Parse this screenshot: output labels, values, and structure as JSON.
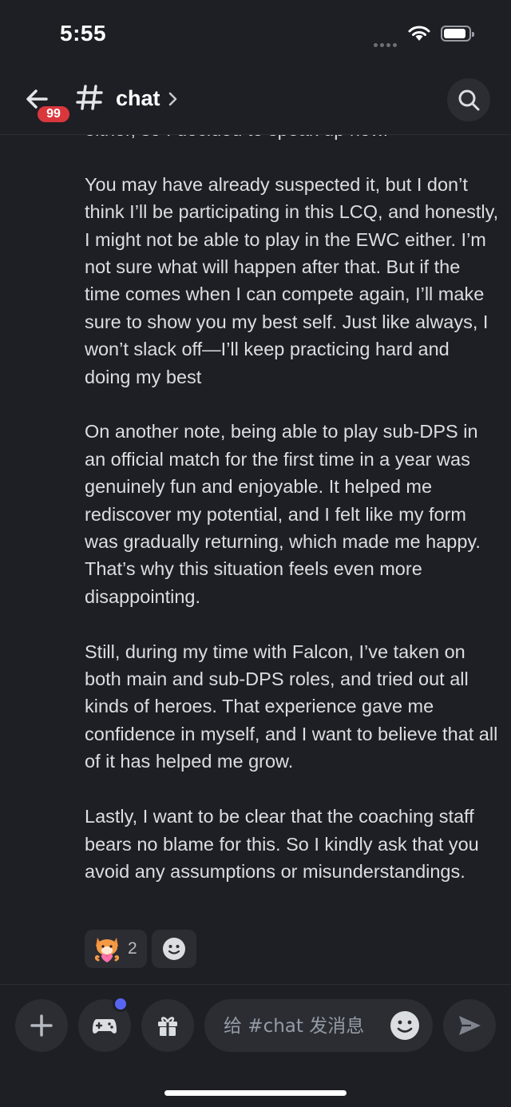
{
  "status": {
    "time": "5:55"
  },
  "header": {
    "back_badge": "99",
    "channel_name": "chat"
  },
  "message": {
    "paragraphs": [
      "either, so I decided to speak up now.",
      "You may have already suspected it, but I don’t think I’ll be participating in this LCQ, and honestly, I might not be able to play in the EWC either. I’m not sure what will happen after that. But if the time comes when I can compete again, I’ll make sure to show you my best self. Just like always, I won’t slack off—I’ll keep practicing hard and doing my best",
      "On another note, being able to play sub-DPS in an official match for the first time in a year was genuinely fun and enjoyable. It helped me rediscover my potential, and I felt like my form was gradually returning, which made me happy. That’s why this situation feels even more disappointing.",
      "Still, during my time with Falcon, I’ve taken on both main and sub-DPS roles, and tried out all kinds of heroes. That experience gave me confidence in myself, and I want to believe that all of it has helped me grow.",
      "Lastly, I want to be clear that the coaching staff bears no blame for this. So I kindly ask that you avoid any assumptions or misunderstandings."
    ],
    "reaction": {
      "emoji": "fox-hug-emoji",
      "count": "2"
    }
  },
  "composer": {
    "placeholder": "给 #chat 发消息"
  },
  "colors": {
    "background": "#1e1f24",
    "surface": "#2b2d33",
    "badge": "#da373c",
    "notify": "#5865f2"
  }
}
